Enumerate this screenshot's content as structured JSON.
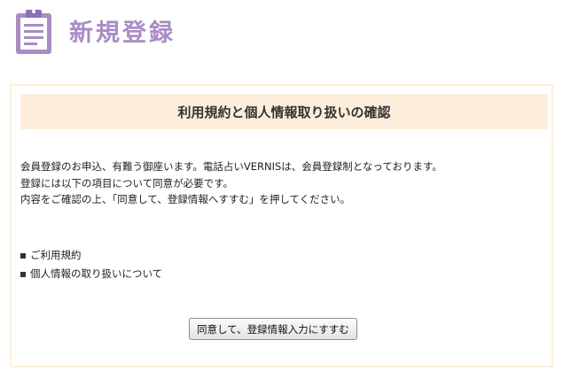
{
  "header": {
    "icon": "clipboard-icon",
    "title": "新規登録"
  },
  "panel": {
    "heading": "利用規約と個人情報取り扱いの確認",
    "intro_lines": [
      "会員登録のお申込、有難う御座います。電話占いVERNISは、会員登録制となっております。",
      "登録には以下の項目について同意が必要です。",
      "内容をご確認の上、「同意して、登録情報へすすむ」を押してください。"
    ],
    "items": [
      "ご利用規約",
      "個人情報の取り扱いについて"
    ],
    "agree_button_label": "同意して、登録情報入力にすすむ"
  },
  "colors": {
    "title": "#a98cc6",
    "icon": "#a98cc6",
    "heading_background": "#fdeedb",
    "panel_border": "#fbf0dd"
  }
}
